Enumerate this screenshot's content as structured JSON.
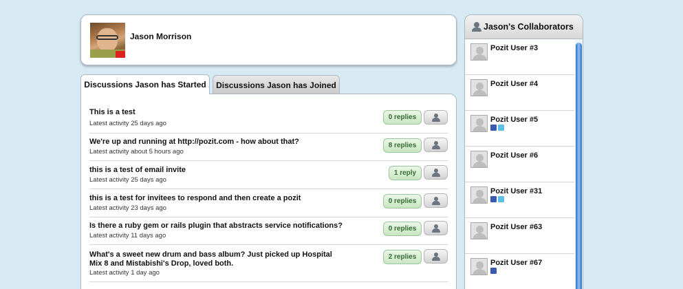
{
  "profile": {
    "name": "Jason Morrison"
  },
  "tabs": {
    "started_label": "Discussions Jason has Started",
    "joined_label": "Discussions Jason has Joined"
  },
  "discussions": [
    {
      "title": "This is a test",
      "meta": "Latest activity 25 days ago",
      "replies": "0 replies"
    },
    {
      "title": "We're up and running at http://pozit.com - how about that?",
      "meta": "Latest activity about 5 hours ago",
      "replies": "8 replies"
    },
    {
      "title": "this is a test of email invite",
      "meta": "Latest activity 25 days ago",
      "replies": "1 reply"
    },
    {
      "title": "this is a test for invitees to respond and then create a pozit",
      "meta": "Latest activity 23 days ago",
      "replies": "0 replies"
    },
    {
      "title": "Is there a ruby gem or rails plugin that abstracts service notifications?",
      "meta": "Latest activity 11 days ago",
      "replies": "0 replies"
    },
    {
      "title": "What's a sweet new drum and bass album? Just picked up Hospital Mix 8 and Mistabishi's Drop, loved both.",
      "meta": "Latest activity 1 day ago",
      "replies": "2 replies"
    }
  ],
  "collaborators": {
    "title": "Jason's Collaborators",
    "users": [
      {
        "name": "Pozit User #3",
        "social": []
      },
      {
        "name": "Pozit User #4",
        "social": []
      },
      {
        "name": "Pozit User #5",
        "social": [
          "facebook-icon",
          "twitter-icon"
        ]
      },
      {
        "name": "Pozit User #6",
        "social": []
      },
      {
        "name": "Pozit User #31",
        "social": [
          "facebook-icon",
          "twitter-icon"
        ]
      },
      {
        "name": "Pozit User #63",
        "social": []
      },
      {
        "name": "Pozit User #67",
        "social": [
          "facebook-icon"
        ]
      }
    ]
  },
  "colors": {
    "background": "#d7e9f2",
    "reply_button": "#c9e6c2",
    "facebook": "#3b5bb0",
    "twitter": "#5ac0e8",
    "scroll_thumb": "#2f6fd0"
  }
}
